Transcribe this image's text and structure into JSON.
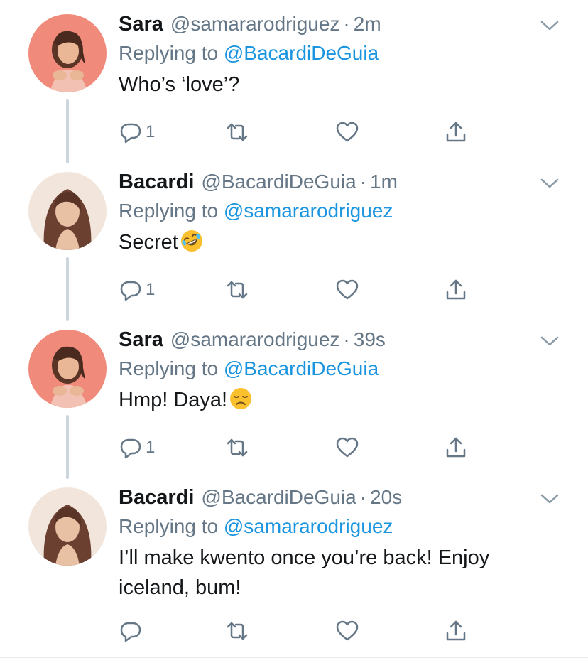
{
  "tweets": [
    {
      "name": "Sara",
      "handle": "@samararodriguez",
      "separator": "·",
      "time": "2m",
      "replying_prefix": "Replying to ",
      "replying_to": "@BacardiDeGuia",
      "text": "Who’s ‘love’?",
      "emoji": "",
      "reply_count": "1"
    },
    {
      "name": "Bacardi",
      "handle": "@BacardiDeGuia",
      "separator": "·",
      "time": "1m",
      "replying_prefix": "Replying to ",
      "replying_to": "@samararodriguez",
      "text": "Secret",
      "emoji": "rolling-on-floor-laughing",
      "reply_count": "1"
    },
    {
      "name": "Sara",
      "handle": "@samararodriguez",
      "separator": "·",
      "time": "39s",
      "replying_prefix": "Replying to ",
      "replying_to": "@BacardiDeGuia",
      "text": "Hmp! Daya!",
      "emoji": "disappointed-face",
      "reply_count": "1"
    },
    {
      "name": "Bacardi",
      "handle": "@BacardiDeGuia",
      "separator": "·",
      "time": "20s",
      "replying_prefix": "Replying to ",
      "replying_to": "@samararodriguez",
      "text_line1": "I’ll make kwento once you’re back! Enjoy",
      "text_line2": "iceland, bum!",
      "emoji": "",
      "reply_count": ""
    }
  ],
  "icons": {
    "reply": "reply-icon",
    "retweet": "retweet-icon",
    "like": "heart-icon",
    "share": "share-icon",
    "caret": "chevron-down-icon"
  },
  "colors": {
    "link": "#1b95e0",
    "secondary": "#657786",
    "thread_line": "#ccd6dd"
  }
}
